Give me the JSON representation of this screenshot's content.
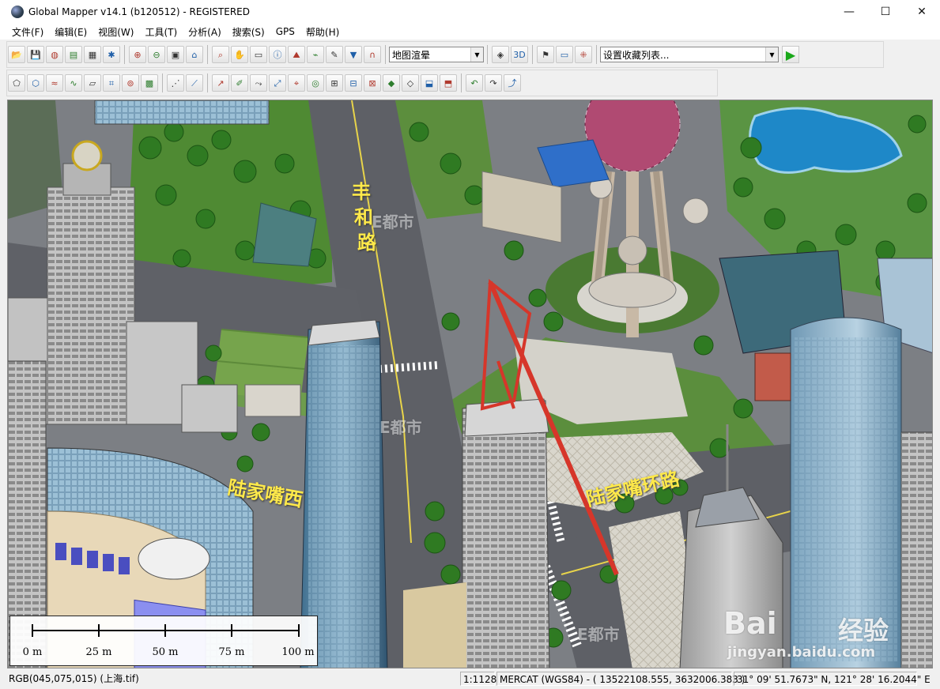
{
  "window": {
    "title": "Global Mapper v14.1 (b120512) - REGISTERED",
    "minimize_glyph": "—",
    "maximize_glyph": "☐",
    "close_glyph": "✕"
  },
  "menu": {
    "items": [
      "文件(F)",
      "编辑(E)",
      "视图(W)",
      "工具(T)",
      "分析(A)",
      "搜索(S)",
      "GPS",
      "帮助(H)"
    ]
  },
  "toolbar1": {
    "icons": [
      "open-folder-icon",
      "save-icon",
      "globe-icon",
      "layer-control-icon",
      "map-catalog-icon",
      "config-icon",
      "zoom-in-icon",
      "zoom-out-icon",
      "zoom-full-icon",
      "home-icon",
      "zoom-tool-icon",
      "pan-tool-icon",
      "measure-icon",
      "info-tool-icon",
      "path-profile-icon",
      "view-shed-icon",
      "digitizer-icon",
      "3d-path-icon",
      "terrain-icon"
    ],
    "icon_glyphs": [
      "📂",
      "💾",
      "◍",
      "▤",
      "▦",
      "✱",
      "⊕",
      "⊖",
      "▣",
      "⌂",
      "⌕",
      "✋",
      "▭",
      "ⓘ",
      "⛰",
      "⌁",
      "✎",
      "▼",
      "∩"
    ],
    "shader_select": "地图渲晕",
    "view3d_icons": [
      "view-3d-icon",
      "3d-label-icon"
    ],
    "view3d_glyphs": [
      "◈",
      "3D"
    ],
    "extra_icons": [
      "lidar-icon",
      "camera-icon",
      "gps-icon"
    ],
    "extra_glyphs": [
      "⚑",
      "▭",
      "⁜"
    ],
    "favorites_select": "设置收藏列表...",
    "run_glyph": "▶"
  },
  "toolbar2": {
    "icons": [
      "create-area-icon",
      "edit-area-icon",
      "create-line-icon",
      "edit-line-icon",
      "create-point-icon",
      "code-feature-icon",
      "combine-icon",
      "grid-icon",
      "move-vertex-icon",
      "split-icon",
      "draw-line-icon",
      "smooth-icon",
      "rotate-icon",
      "scale-icon",
      "snap-icon",
      "buffer-icon",
      "union-icon",
      "intersect-icon",
      "grid-area-icon",
      "filled-area-icon",
      "selection-icon",
      "crop-icon",
      "fill-icon",
      "undo-icon",
      "redo-icon",
      "transform-icon"
    ],
    "icon_glyphs": [
      "⬠",
      "⬡",
      "≈",
      "∿",
      "▱",
      "⌗",
      "⊚",
      "▩",
      "⋰",
      "⟋",
      "↗",
      "✐",
      "⤳",
      "⤢",
      "⌖",
      "◎",
      "⊞",
      "⊟",
      "⊠",
      "◆",
      "◇",
      "⬓",
      "⬒",
      "↶",
      "↷",
      "⤴"
    ]
  },
  "map": {
    "road_labels": [
      "丰",
      "和",
      "路",
      "陆家嘴西",
      "陆家嘴环路"
    ],
    "watermarks": [
      "E都市",
      "E都市",
      "E都市",
      "Bai",
      "经验",
      "jingyan.baidu.com"
    ],
    "scale_ticks": [
      "0 m",
      "25 m",
      "50 m",
      "75 m",
      "100 m"
    ]
  },
  "status": {
    "pixel_value": "RGB(045,075,015) (上海.tif)",
    "scale": "1:1128",
    "projection": "MERCAT (WGS84) - ( 13522108.555, 3632006.383 )",
    "latlon": "31° 09' 51.7673\" N, 121° 28' 16.2044\" E"
  },
  "colors": {
    "road": "#5e6066",
    "grass": "#4f8a33",
    "tree": "#2f7a22",
    "glass": "#4a7fa0",
    "label": "#ffe94a",
    "tower_pink": "#b04a72",
    "crane": "#d6362a",
    "water": "#1e88c8"
  }
}
